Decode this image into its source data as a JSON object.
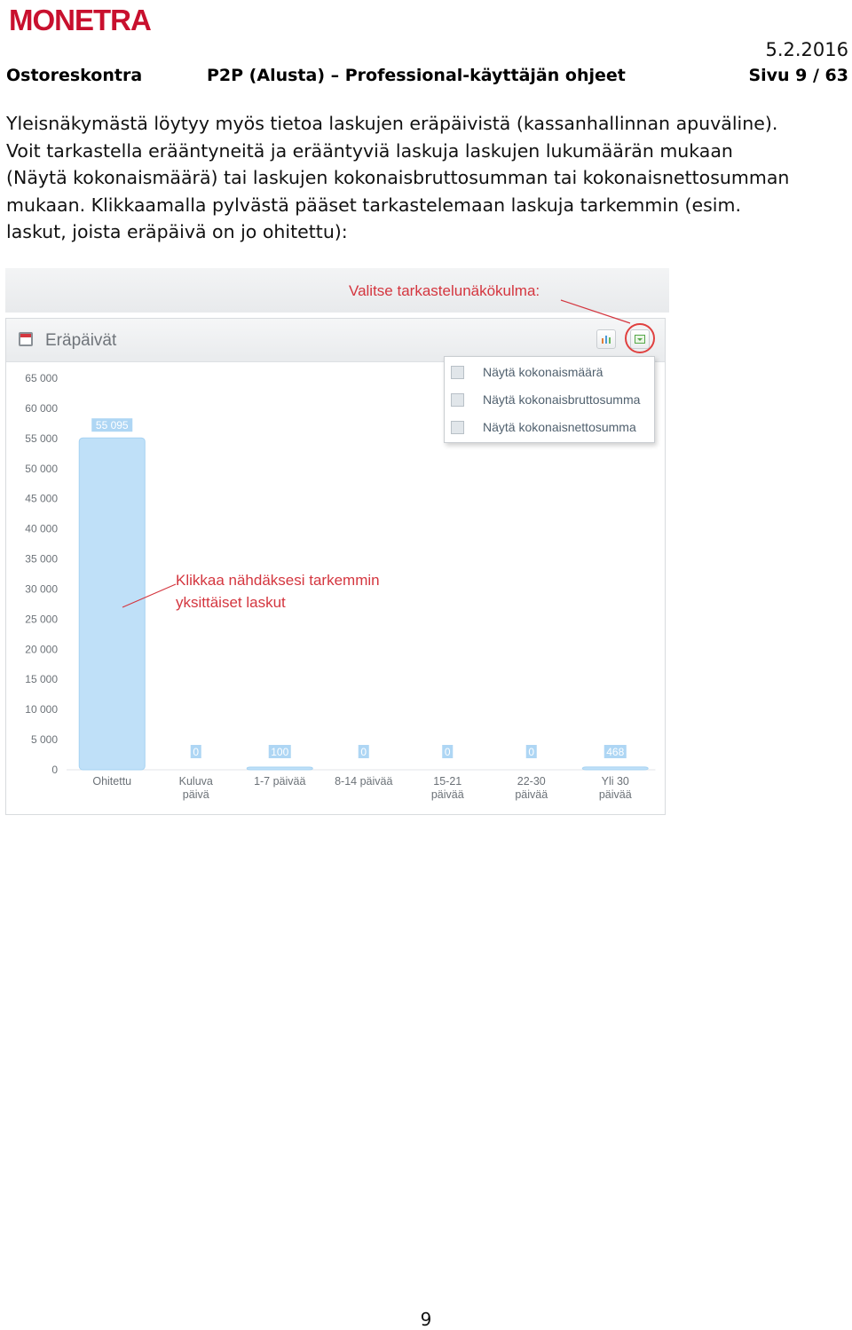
{
  "logo": {
    "text": "MONETRA"
  },
  "date": "5.2.2016",
  "header": {
    "left": "Ostoreskontra",
    "middle": "P2P (Alusta) – Professional-käyttäjän ohjeet",
    "right": "Sivu 9 / 63"
  },
  "paragraph": "Yleisnäkymästä löytyy myös tietoa laskujen eräpäivistä (kassanhallinnan apuväline).\nVoit tarkastella erääntyneitä ja erääntyviä laskuja laskujen lukumäärän mukaan\n(Näytä kokonaismäärä) tai laskujen kokonaisbruttosumman tai kokonaisnettosumman\nmukaan. Klikkaamalla pylvästä pääset tarkastelemaan laskuja tarkemmin (esim.\nlaskut, joista eräpäivä on jo ohitettu):",
  "figure": {
    "callout_top": "Valitse tarkastelunäkökulma:",
    "callout_bar_line1": "Klikkaa nähdäksesi tarkemmin",
    "callout_bar_line2": "yksittäiset laskut",
    "panel_title": "Eräpäivät",
    "menu": [
      {
        "label": "Näytä kokonaismäärä",
        "icon": "table-icon"
      },
      {
        "label": "Näytä kokonaisbruttosumma",
        "icon": "table-icon"
      },
      {
        "label": "Näytä kokonaisnettosumma",
        "icon": "table-icon"
      }
    ],
    "colors": {
      "bar": "#bfe0f8",
      "bar_edge": "#a6d2f2",
      "label_bg": "#aed6f4",
      "callout": "#d4363f"
    }
  },
  "chart_data": {
    "type": "bar",
    "title": "Eräpäivät",
    "categories": [
      "Ohitettu",
      "Kuluva\npäivä",
      "1-7 päivää",
      "8-14 päivää",
      "15-21\npäivää",
      "22-30\npäivää",
      "Yli 30\npäivää"
    ],
    "values": [
      55095,
      0,
      100,
      0,
      0,
      0,
      468
    ],
    "data_labels": [
      "55 095",
      "0",
      "100",
      "0",
      "0",
      "0",
      "468"
    ],
    "yticks": [
      "0",
      "5 000",
      "10 000",
      "15 000",
      "20 000",
      "25 000",
      "30 000",
      "35 000",
      "40 000",
      "45 000",
      "50 000",
      "55 000",
      "60 000",
      "65 000"
    ],
    "ylim": [
      0,
      65000
    ],
    "grid": false,
    "legend": "none"
  },
  "page_number": "9"
}
